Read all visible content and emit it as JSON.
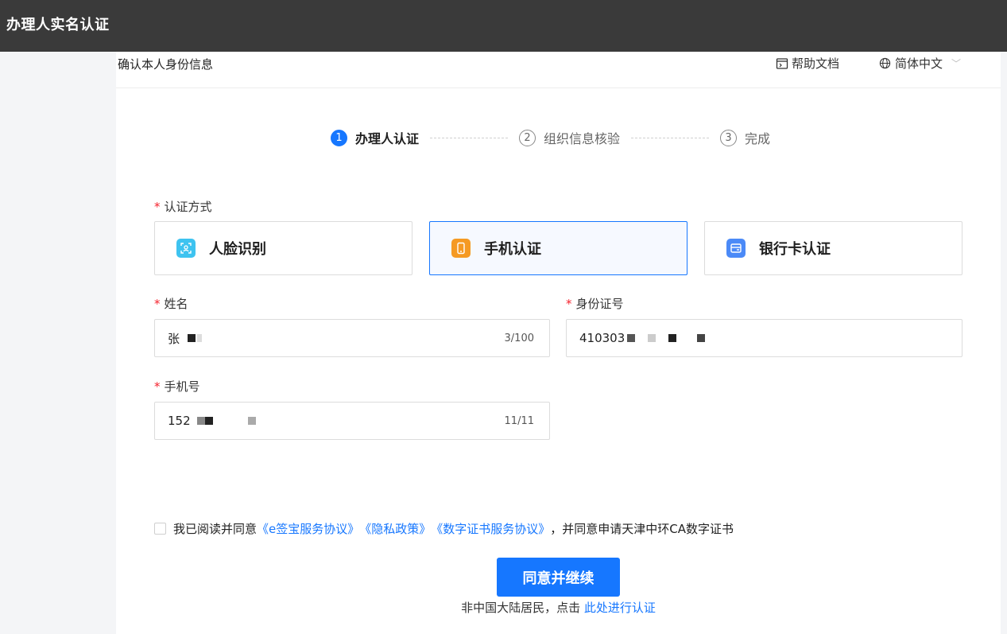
{
  "app": {
    "title": "办理人实名认证"
  },
  "header": {
    "page_title": "确认本人身份信息",
    "help_label": "帮助文档",
    "language_label": "简体中文"
  },
  "steps": [
    {
      "num": "1",
      "label": "办理人认证",
      "state": "active"
    },
    {
      "num": "2",
      "label": "组织信息核验",
      "state": "pending"
    },
    {
      "num": "3",
      "label": "完成",
      "state": "pending"
    }
  ],
  "form": {
    "required_mark": "*",
    "method_label": "认证方式",
    "methods": [
      {
        "label": "人脸识别",
        "icon": "face-scan-icon",
        "color": "#3ec3f0",
        "selected": false
      },
      {
        "label": "手机认证",
        "icon": "phone-icon",
        "color": "#f59a23",
        "selected": true
      },
      {
        "label": "银行卡认证",
        "icon": "bank-card-icon",
        "color": "#4b8af7",
        "selected": false
      }
    ],
    "name": {
      "label": "姓名",
      "value": "张",
      "count": "3/100"
    },
    "id_number": {
      "label": "身份证号",
      "value": "410303"
    },
    "phone": {
      "label": "手机号",
      "value": "152",
      "count": "11/11"
    }
  },
  "agreement": {
    "prefix": "我已阅读并同意",
    "link1": "《e签宝服务协议》",
    "link2": "《隐私政策》",
    "link3": "《数字证书服务协议》",
    "suffix": "，并同意申请天津中环CA数字证书",
    "checked": false
  },
  "submit_label": "同意并继续",
  "footer": {
    "text": "非中国大陆居民，点击 ",
    "link": "此处进行认证"
  },
  "colors": {
    "accent": "#1677ff",
    "topbar": "#3a3a3a",
    "required": "#f5222d"
  }
}
